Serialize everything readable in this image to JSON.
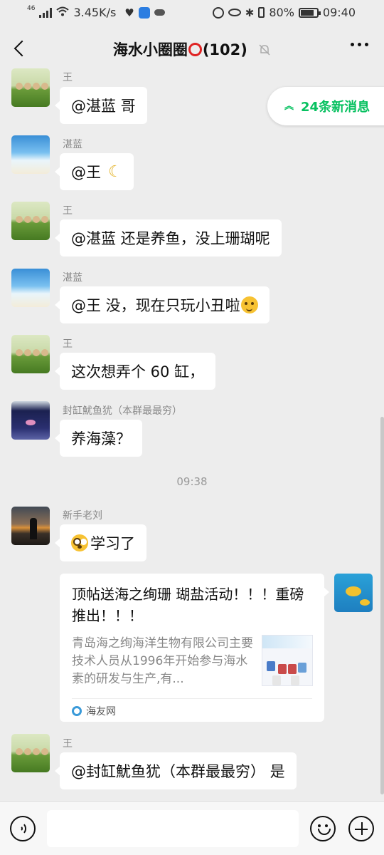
{
  "status_bar": {
    "network": "46",
    "speed": "3.45K/s",
    "battery_text": "80%",
    "battery_level": 0.8,
    "time": "09:40"
  },
  "header": {
    "title_prefix": "海水小圈圈",
    "title_suffix": "(102)",
    "icons": [
      "back-chevron-icon",
      "red-circle-emoji",
      "mute-bell-icon",
      "more-dots-icon"
    ]
  },
  "new_messages": {
    "label": "24条新消息",
    "icon": "double-chevron-up-icon"
  },
  "messages": [
    {
      "sender": "王",
      "text": "@湛蓝  哥"
    },
    {
      "sender": "湛蓝",
      "text": "@王 ",
      "emoji": "banana-emoji"
    },
    {
      "sender": "王",
      "text": "@湛蓝  还是养鱼，没上珊瑚呢"
    },
    {
      "sender": "湛蓝",
      "text": "@王  没，现在只玩小丑啦",
      "emoji": "smirk-emoji"
    },
    {
      "sender": "王",
      "text": "这次想弄个 60 缸，"
    },
    {
      "sender": "封缸魷鱼犹（本群最最穷）",
      "text": "养海藻？"
    },
    {
      "sender": "新手老刘",
      "text": "学习了",
      "emoji": "shocked-emoji"
    },
    {
      "sender": "王",
      "text": "@封缸魷鱼犹（本群最最穷） 是"
    }
  ],
  "time_separator": "09:38",
  "link_card": {
    "title": "顶帖送海之绚珊 瑚盐活动！！！重磅推出！！！",
    "description": "青岛海之绚海洋生物有限公司主要技术人员从1996年开始参与海水素的研发与生产,有...",
    "source": "海友网"
  },
  "input_bar": {
    "placeholder": "",
    "icons": [
      "voice-icon",
      "emoji-icon",
      "plus-icon"
    ]
  }
}
